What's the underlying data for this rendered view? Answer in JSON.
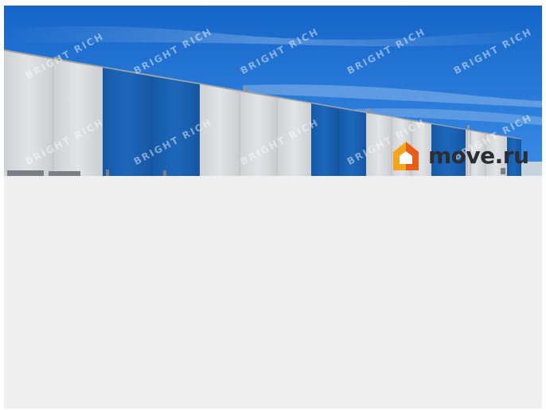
{
  "image": {
    "watermark_text": "BRIGHT RICH",
    "logo_text": "move.ru",
    "logo_mark_colors": [
      "#f7a41d",
      "#e85d1a"
    ],
    "sky_color": "#1e74d9",
    "wall_colors": [
      "#d6d7d9",
      "#1a5fb0"
    ]
  }
}
